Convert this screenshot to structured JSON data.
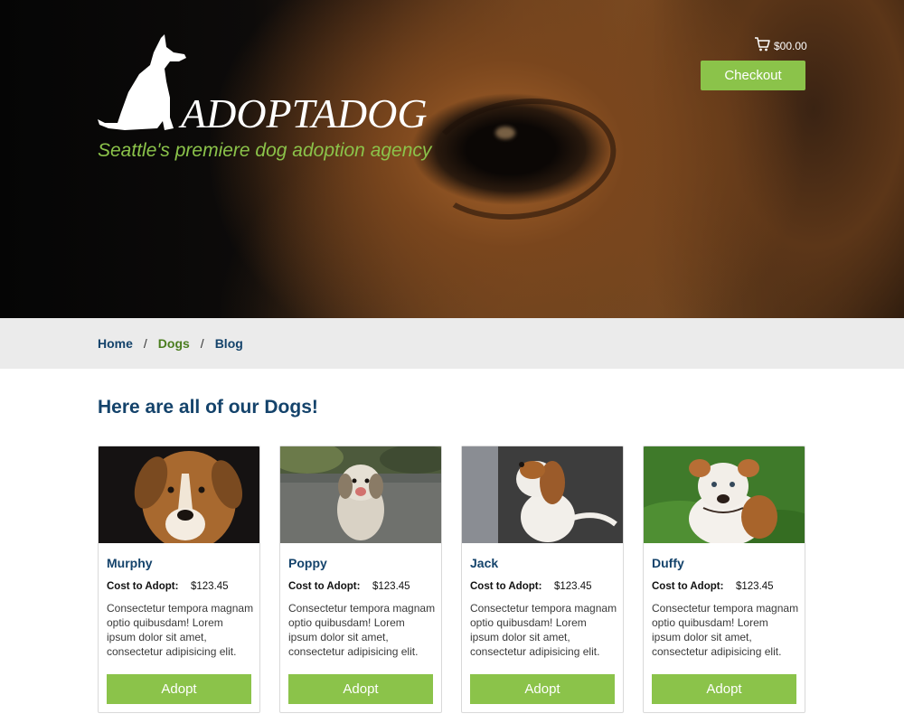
{
  "header": {
    "logo_text": "ADOPTADOG",
    "tagline": "Seattle's premiere dog adoption agency",
    "cart_amount": "$00.00",
    "checkout_label": "Checkout",
    "cart_icon": "shopping-cart-icon",
    "logo_icon": "sitting-dog-silhouette-icon"
  },
  "breadcrumb": [
    {
      "label": "Home"
    },
    {
      "label": "Dogs"
    },
    {
      "label": "Blog"
    }
  ],
  "breadcrumb_separator": "/",
  "main": {
    "heading": "Here are all of our Dogs!"
  },
  "dogs": [
    {
      "name": "Murphy",
      "cost_label": "Cost to Adopt:",
      "cost": "$123.45",
      "description": "Consectetur tempora magnam optio quibusdam! Lorem ipsum dolor sit amet, consectetur adipisicing elit.",
      "adopt_label": "Adopt"
    },
    {
      "name": "Poppy",
      "cost_label": "Cost to Adopt:",
      "cost": "$123.45",
      "description": "Consectetur tempora magnam optio quibusdam! Lorem ipsum dolor sit amet, consectetur adipisicing elit.",
      "adopt_label": "Adopt"
    },
    {
      "name": "Jack",
      "cost_label": "Cost to Adopt:",
      "cost": "$123.45",
      "description": "Consectetur tempora magnam optio quibusdam! Lorem ipsum dolor sit amet, consectetur adipisicing elit.",
      "adopt_label": "Adopt"
    },
    {
      "name": "Duffy",
      "cost_label": "Cost to Adopt:",
      "cost": "$123.45",
      "description": "Consectetur tempora magnam optio quibusdam! Lorem ipsum dolor sit amet, consectetur adipisicing elit.",
      "adopt_label": "Adopt"
    }
  ],
  "colors": {
    "accent_green": "#8bc34a",
    "navy": "#14436b",
    "breadcrumb_bar": "#ebebeb"
  }
}
